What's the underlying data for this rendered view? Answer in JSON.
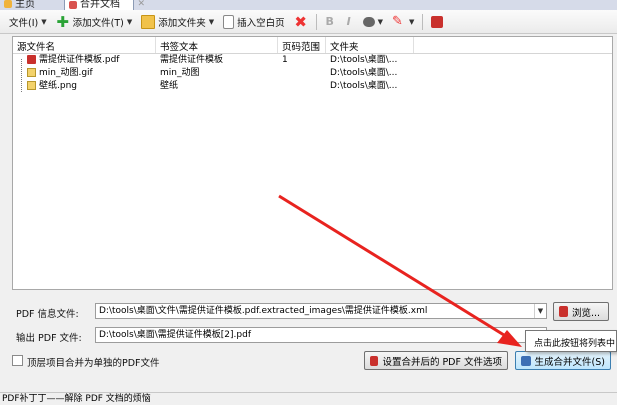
{
  "tabs": [
    {
      "label": "主页"
    },
    {
      "label": "合并文档"
    }
  ],
  "toolbar": {
    "file_menu": "文件(I)",
    "add_file": "添加文件(T)",
    "add_folder": "添加文件夹",
    "insert_blank": "插入空白页"
  },
  "table": {
    "headers": [
      "源文件名",
      "书签文本",
      "页码范围",
      "文件夹"
    ],
    "rows": [
      {
        "name": "需提供证件模板.pdf",
        "type": "pdf",
        "bookmark": "需提供证件模板",
        "range": "1",
        "folder": "D:\\tools\\桌面\\..."
      },
      {
        "name": "min_动图.gif",
        "type": "image",
        "bookmark": "min_动图",
        "range": "",
        "folder": "D:\\tools\\桌面\\..."
      },
      {
        "name": "壁纸.png",
        "type": "image",
        "bookmark": "壁纸",
        "range": "",
        "folder": "D:\\tools\\桌面\\..."
      }
    ]
  },
  "pdf_info": {
    "label": "PDF 信息文件:",
    "value": "D:\\tools\\桌面\\文件\\需提供证件模板.pdf.extracted_images\\需提供证件模板.xml",
    "browse_label": "浏览..."
  },
  "output": {
    "label": "输出 PDF 文件:",
    "value": "D:\\tools\\桌面\\需提供证件模板[2].pdf"
  },
  "options": {
    "merge_top_level": "顶层项目合并为单独的PDF文件",
    "settings_button": "设置合并后的 PDF 文件选项",
    "merge_button": "生成合并文件(S)"
  },
  "tooltip": "点击此按钮将列表中",
  "status": "PDF补丁丁——解除 PDF 文档的烦恼",
  "colors": {
    "arrow": "#e8231f",
    "accent": "#3c7fb1"
  }
}
